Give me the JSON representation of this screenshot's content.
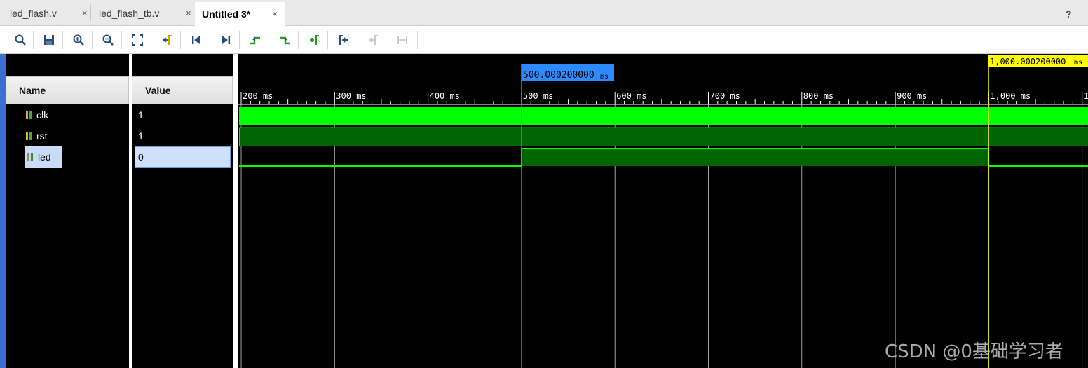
{
  "tabs": [
    {
      "label": "led_flash.v",
      "active": false
    },
    {
      "label": "led_flash_tb.v",
      "active": false
    },
    {
      "label": "Untitled 3*",
      "active": true
    }
  ],
  "close_glyph": "×",
  "help": {
    "question": "?"
  },
  "toolbar_icons": [
    "search-icon",
    "save-icon",
    "zoom-in-icon",
    "zoom-out-icon",
    "zoom-fit-icon",
    "go-to-cursor-icon",
    "go-to-time-zero-icon",
    "go-to-last-time-icon",
    "previous-transition-icon",
    "next-transition-icon",
    "add-marker-icon",
    "previous-marker-icon",
    "next-marker-icon",
    "swap-cursors-icon"
  ],
  "columns": {
    "name": "Name",
    "value": "Value"
  },
  "signals": [
    {
      "name": "clk",
      "value": "1",
      "selected": false
    },
    {
      "name": "rst",
      "value": "1",
      "selected": false
    },
    {
      "name": "led",
      "value": "0",
      "selected": true
    }
  ],
  "timeline": {
    "ticks": [
      "200 ms",
      "300 ms",
      "400 ms",
      "500 ms",
      "600 ms",
      "700 ms",
      "800 ms",
      "900 ms",
      "1,000 ms",
      "1"
    ],
    "cursor_value": "500.000200000",
    "cursor_unit": "ms",
    "marker_value": "1,000.000200000",
    "marker_unit": "ms"
  },
  "colors": {
    "wave_bright": "#00ff00",
    "wave_dark": "#006400",
    "cursor": "#2e8bff",
    "marker": "#ffff00",
    "grid": "#ffffff"
  },
  "watermark": "CSDN @0基础学习者"
}
